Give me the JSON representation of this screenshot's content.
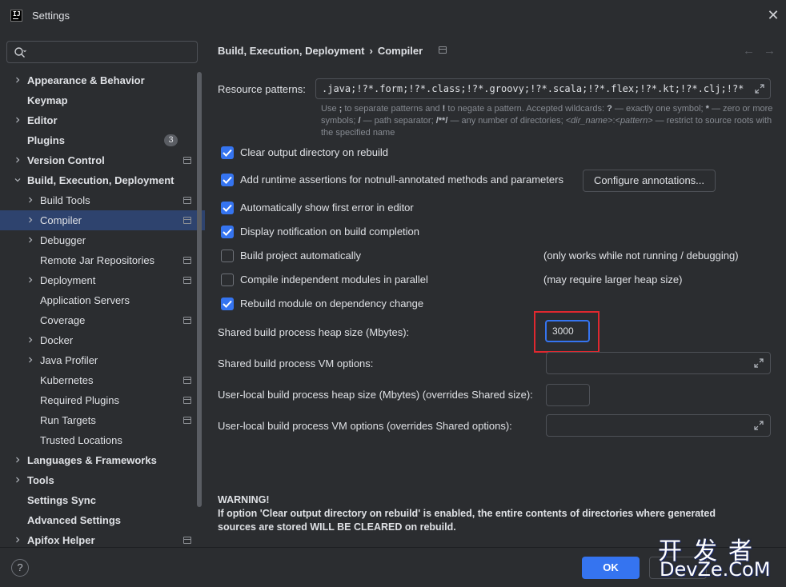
{
  "window": {
    "title": "Settings"
  },
  "search": {
    "placeholder": ""
  },
  "sidebar": {
    "items": [
      {
        "label": "Appearance & Behavior",
        "level": 0,
        "arrow": true,
        "bold": true,
        "proj": false
      },
      {
        "label": "Keymap",
        "level": 0,
        "arrow": false,
        "bold": true,
        "proj": false
      },
      {
        "label": "Editor",
        "level": 0,
        "arrow": true,
        "bold": true,
        "proj": false
      },
      {
        "label": "Plugins",
        "level": 0,
        "arrow": false,
        "bold": true,
        "proj": false,
        "badge": "3"
      },
      {
        "label": "Version Control",
        "level": 0,
        "arrow": true,
        "bold": true,
        "proj": true
      },
      {
        "label": "Build, Execution, Deployment",
        "level": 0,
        "arrow": "down",
        "bold": true,
        "proj": false
      },
      {
        "label": "Build Tools",
        "level": 1,
        "arrow": true,
        "bold": false,
        "proj": true
      },
      {
        "label": "Compiler",
        "level": 1,
        "arrow": true,
        "bold": false,
        "proj": true,
        "selected": true
      },
      {
        "label": "Debugger",
        "level": 1,
        "arrow": true,
        "bold": false,
        "proj": false
      },
      {
        "label": "Remote Jar Repositories",
        "level": 1,
        "arrow": false,
        "bold": false,
        "proj": true
      },
      {
        "label": "Deployment",
        "level": 1,
        "arrow": true,
        "bold": false,
        "proj": true
      },
      {
        "label": "Application Servers",
        "level": 1,
        "arrow": false,
        "bold": false,
        "proj": false
      },
      {
        "label": "Coverage",
        "level": 1,
        "arrow": false,
        "bold": false,
        "proj": true
      },
      {
        "label": "Docker",
        "level": 1,
        "arrow": true,
        "bold": false,
        "proj": false
      },
      {
        "label": "Java Profiler",
        "level": 1,
        "arrow": true,
        "bold": false,
        "proj": false
      },
      {
        "label": "Kubernetes",
        "level": 1,
        "arrow": false,
        "bold": false,
        "proj": true
      },
      {
        "label": "Required Plugins",
        "level": 1,
        "arrow": false,
        "bold": false,
        "proj": true
      },
      {
        "label": "Run Targets",
        "level": 1,
        "arrow": false,
        "bold": false,
        "proj": true
      },
      {
        "label": "Trusted Locations",
        "level": 1,
        "arrow": false,
        "bold": false,
        "proj": false
      },
      {
        "label": "Languages & Frameworks",
        "level": 0,
        "arrow": true,
        "bold": true,
        "proj": false
      },
      {
        "label": "Tools",
        "level": 0,
        "arrow": true,
        "bold": true,
        "proj": false
      },
      {
        "label": "Settings Sync",
        "level": 0,
        "arrow": false,
        "bold": true,
        "proj": false
      },
      {
        "label": "Advanced Settings",
        "level": 0,
        "arrow": false,
        "bold": true,
        "proj": false
      },
      {
        "label": "Apifox Helper",
        "level": 0,
        "arrow": true,
        "bold": true,
        "proj": true
      }
    ]
  },
  "breadcrumb": {
    "parent": "Build, Execution, Deployment",
    "separator": "›",
    "current": "Compiler"
  },
  "nav": {
    "back": "←",
    "forward": "→"
  },
  "compiler": {
    "resource_label": "Resource patterns:",
    "resource_value": ".java;!?*.form;!?*.class;!?*.groovy;!?*.scala;!?*.flex;!?*.kt;!?*.clj;!?*.aj",
    "hint_line1_a": "Use ",
    "hint_line1_b": ";",
    "hint_line1_c": " to separate patterns and ",
    "hint_line1_d": "!",
    "hint_line1_e": " to negate a pattern. Accepted wildcards: ",
    "hint_line1_f": "?",
    "hint_line1_g": " — exactly one symbol; ",
    "hint_line1_h": "*",
    "hint_line1_i": " — zero or more symbols; ",
    "hint_line2_a": "/",
    "hint_line2_b": " — path separator; ",
    "hint_line2_c": "/**/",
    "hint_line2_d": " — any number of directories; ",
    "hint_line2_e": "<dir_name>",
    "hint_line2_f": ":",
    "hint_line2_g": "<pattern>",
    "hint_line2_h": " — restrict to source roots with the specified name",
    "options": [
      {
        "label": "Clear output directory on rebuild",
        "checked": true
      },
      {
        "label": "Add runtime assertions for notnull-annotated methods and parameters",
        "checked": true
      },
      {
        "label": "Automatically show first error in editor",
        "checked": true
      },
      {
        "label": "Display notification on build completion",
        "checked": true
      },
      {
        "label": "Build project automatically",
        "checked": false,
        "note": "(only works while not running / debugging)"
      },
      {
        "label": "Compile independent modules in parallel",
        "checked": false,
        "note": "(may require larger heap size)"
      },
      {
        "label": "Rebuild module on dependency change",
        "checked": true
      }
    ],
    "configure_button": "Configure annotations...",
    "heap_label": "Shared build process heap size (Mbytes):",
    "heap_value": "3000",
    "vm_label": "Shared build process VM options:",
    "vm_value": "",
    "user_heap_label": "User-local build process heap size (Mbytes) (overrides Shared size):",
    "user_heap_value": "",
    "user_vm_label": "User-local build process VM options (overrides Shared options):",
    "user_vm_value": "",
    "warning_title": "WARNING!",
    "warning_line1": "If option 'Clear output directory on rebuild' is enabled, the entire contents of directories where generated",
    "warning_line2": "sources are stored WILL BE CLEARED on rebuild."
  },
  "footer": {
    "help": "?",
    "ok": "OK",
    "cancel": ""
  },
  "watermark": {
    "top": "开发者",
    "bottom": "DevZe.CoM"
  },
  "colors": {
    "accent": "#3574f0",
    "selection": "#2e436e",
    "highlight_box": "#e0282f",
    "background": "#2b2d30"
  }
}
